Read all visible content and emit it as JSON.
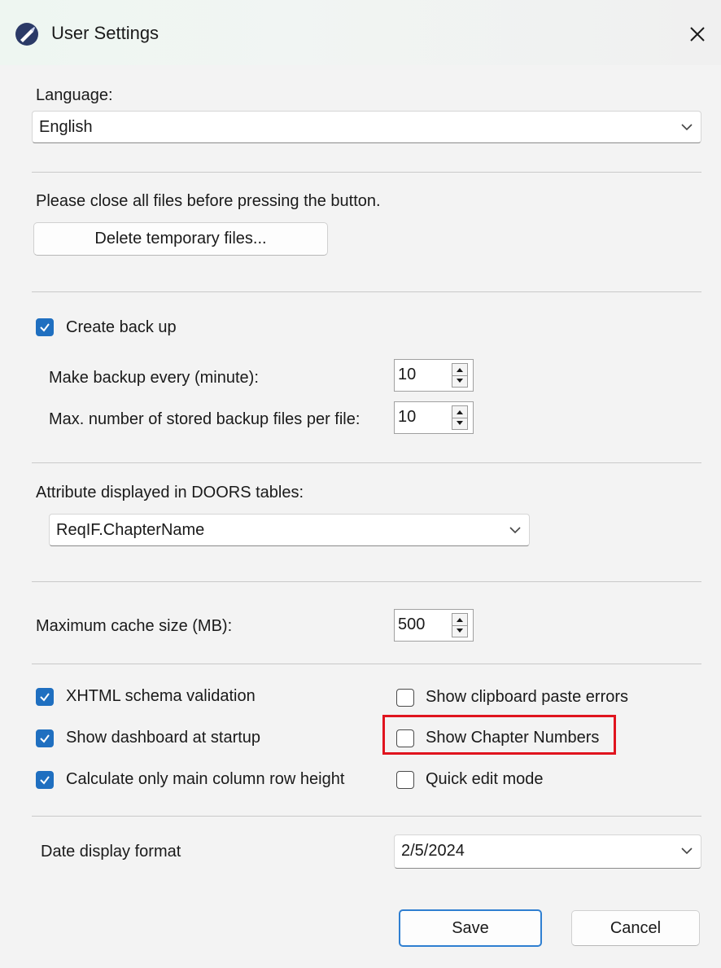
{
  "window": {
    "title": "User Settings"
  },
  "language": {
    "label": "Language:",
    "value": "English"
  },
  "temp_files": {
    "note": "Please close all files before pressing the button.",
    "button": "Delete temporary files..."
  },
  "backup": {
    "checkbox_label": "Create back up",
    "checked": true,
    "interval_label": "Make backup every (minute):",
    "interval_value": "10",
    "max_files_label": "Max. number of stored backup files per file:",
    "max_files_value": "10"
  },
  "doors": {
    "label": "Attribute displayed in DOORS tables:",
    "value": "ReqIF.ChapterName"
  },
  "cache": {
    "label": "Maximum cache size (MB):",
    "value": "500"
  },
  "options": {
    "xhtml_validation": {
      "label": "XHTML schema validation",
      "checked": true
    },
    "dashboard_startup": {
      "label": "Show dashboard at startup",
      "checked": true
    },
    "main_column_height": {
      "label": "Calculate only main column row height",
      "checked": true
    },
    "clipboard_errors": {
      "label": "Show clipboard paste errors",
      "checked": false
    },
    "chapter_numbers": {
      "label": "Show Chapter Numbers",
      "checked": false
    },
    "quick_edit": {
      "label": "Quick edit mode",
      "checked": false
    }
  },
  "date_format": {
    "label": "Date display format",
    "value": "2/5/2024"
  },
  "footer": {
    "save": "Save",
    "cancel": "Cancel"
  },
  "colors": {
    "accent": "#1f6fc0",
    "highlight": "#e0141e"
  },
  "icons": {
    "app": "app-logo-icon",
    "close": "close-icon",
    "dropdown": "chevron-down-icon",
    "check": "checkmark-icon",
    "spinner": "spinner-arrows-icon"
  }
}
